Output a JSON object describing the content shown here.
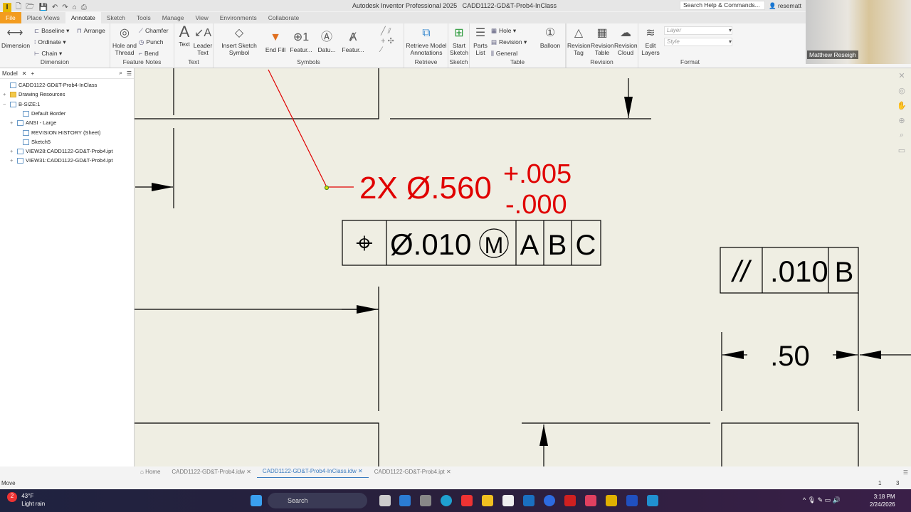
{
  "app": {
    "title": "Autodesk Inventor Professional 2025",
    "document": "CADD1122-GD&T-Prob4-InClass",
    "search_placeholder": "Search Help & Commands...",
    "user": "resematt"
  },
  "tabs": [
    "File",
    "Place Views",
    "Annotate",
    "Sketch",
    "Tools",
    "Manage",
    "View",
    "Environments",
    "Collaborate"
  ],
  "ribbon": {
    "dimension": {
      "label": "Dimension",
      "dimension": "Dimension",
      "baseline": "Baseline",
      "ordinate": "Ordinate",
      "chain": "Chain",
      "arrange": "Arrange"
    },
    "feature_notes": {
      "label": "Feature Notes",
      "hole": "Hole and Thread",
      "chamfer": "Chamfer",
      "punch": "Punch",
      "bend": "Bend"
    },
    "text": {
      "label": "Text",
      "text": "Text",
      "leader": "Leader Text"
    },
    "symbols": {
      "label": "Symbols",
      "insert": "Insert Sketch Symbol",
      "endfill": "End Fill",
      "featur1": "Featur...",
      "datu": "Datu...",
      "featur2": "Featur..."
    },
    "retrieve": {
      "label": "Retrieve",
      "btn": "Retrieve Model Annotations"
    },
    "sketch": {
      "label": "Sketch",
      "btn": "Start Sketch"
    },
    "table": {
      "label": "Table",
      "parts": "Parts List",
      "hole": "Hole",
      "revision": "Revision",
      "general": "General"
    },
    "balloon": "Balloon",
    "revision": {
      "label": "Revision",
      "tag": "Revision Tag",
      "table": "Revision Table",
      "cloud": "Revision Cloud"
    },
    "format": {
      "label": "Format",
      "edit": "Edit Layers",
      "layer": "Layer",
      "style": "Style"
    }
  },
  "video": {
    "name": "Matthew Reseigh"
  },
  "browser": {
    "tab": "Model",
    "items": [
      {
        "label": "CADD1122-GD&T-Prob4-InClass",
        "pm": ""
      },
      {
        "label": "Drawing Resources",
        "pm": "+"
      },
      {
        "label": "B-SIZE:1",
        "pm": "−"
      },
      {
        "label": "Default Border",
        "pm": ""
      },
      {
        "label": "ANSI - Large",
        "pm": "+"
      },
      {
        "label": "REVISION HISTORY (Sheet)",
        "pm": ""
      },
      {
        "label": "Sketch5",
        "pm": ""
      },
      {
        "label": "VIEW28:CADD1122-GD&T-Prob4.ipt",
        "pm": "+"
      },
      {
        "label": "VIEW31:CADD1122-GD&T-Prob4.ipt",
        "pm": "+"
      }
    ]
  },
  "drawing": {
    "hole_note": "2X Ø.560",
    "tol_plus": "+.005",
    "tol_minus": "-.000",
    "fcf1": {
      "symbol": "⌖",
      "tol": "Ø.010",
      "modifier": "M",
      "datums": [
        "A",
        "B",
        "C"
      ]
    },
    "fcf2": {
      "symbol": "//",
      "tol": ".010",
      "datum": "B"
    },
    "dim": ".50",
    "accent": "#e00000"
  },
  "doc_tabs": [
    "Home",
    "CADD1122-GD&T-Prob4.idw",
    "CADD1122-GD&T-Prob4-InClass.idw",
    "CADD1122-GD&T-Prob4.ipt"
  ],
  "status": {
    "text": "Move",
    "n1": "1",
    "n2": "3"
  },
  "taskbar": {
    "weather_temp": "43°F",
    "weather_desc": "Light rain",
    "search": "Search",
    "time": "3:18 PM",
    "date": "2/24/2026",
    "badge": "2"
  }
}
